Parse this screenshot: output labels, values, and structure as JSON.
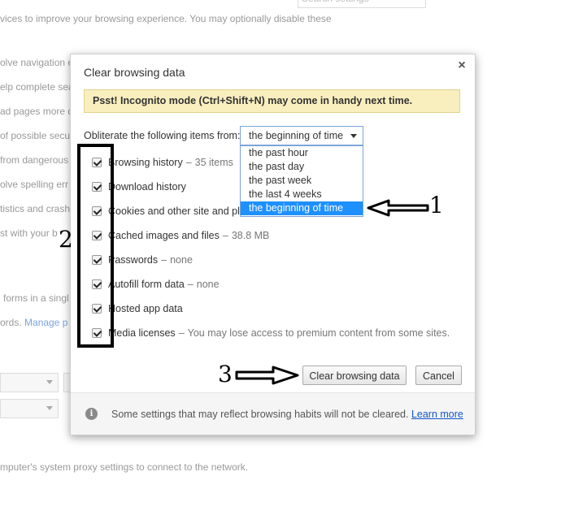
{
  "background": {
    "search_placeholder": "Search settings",
    "lines": [
      "vices to improve your browsing experience. You may optionally disable these",
      "olve navigation e",
      "elp complete sea",
      "ad pages more q",
      "of possible secur",
      "from dangerous",
      "olve spelling err",
      "tistics and crash",
      "st with your b",
      "forms in a singl",
      "ords.",
      "mputer's system proxy settings to connect to the network."
    ],
    "manage_link": "Manage p"
  },
  "dialog": {
    "title": "Clear browsing data",
    "close_symbol": "×",
    "banner": "Psst! Incognito mode (Ctrl+Shift+N) may come in handy next time.",
    "obliterate_label": "Obliterate the following items from:",
    "time_range": {
      "selected": "the beginning of time",
      "options": [
        "the past hour",
        "the past day",
        "the past week",
        "the last 4 weeks",
        "the beginning of time"
      ]
    },
    "items": [
      {
        "label": "Browsing history",
        "detail": "35 items"
      },
      {
        "label": "Download history",
        "detail": ""
      },
      {
        "label": "Cookies and other site and plugin data",
        "detail": ""
      },
      {
        "label": "Cached images and files",
        "detail": "38.8 MB"
      },
      {
        "label": "Passwords",
        "detail": "none"
      },
      {
        "label": "Autofill form data",
        "detail": "none"
      },
      {
        "label": "Hosted app data",
        "detail": ""
      },
      {
        "label": "Media licenses",
        "detail": "You may lose access to premium content from some sites."
      }
    ],
    "separator": "–",
    "clear_button": "Clear browsing data",
    "cancel_button": "Cancel",
    "footer_text": "Some settings that may reflect browsing habits will not be cleared.",
    "footer_link": "Learn more",
    "info_icon": "i"
  },
  "annotations": {
    "one": "1",
    "two": "2",
    "three": "3"
  }
}
